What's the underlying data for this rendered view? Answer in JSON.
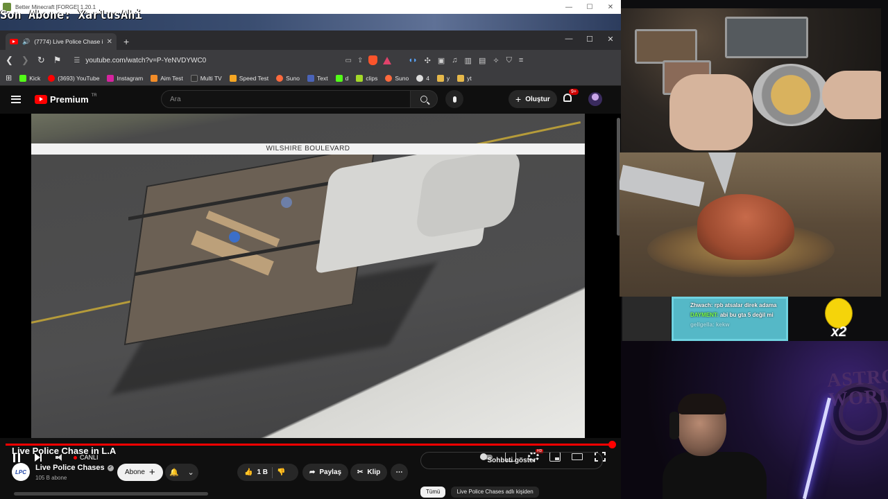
{
  "overlay": {
    "window_title": "Better Minecraft [FORGE] 1.20.1",
    "last_subscriber": "Son Abone: XarlusAhi",
    "window_controls": [
      "—",
      "☐",
      "✕"
    ]
  },
  "browser": {
    "tab_title": "(7774) Live Police Chase in L.A",
    "new_tab_symbol": "+",
    "url": "youtube.com/watch?v=P-YeNVDYWC0",
    "bookmarks": [
      {
        "label": "Kick",
        "color": "#53fc18"
      },
      {
        "label": "(3693) YouTube",
        "color": "#ff0000"
      },
      {
        "label": "Instagram",
        "color": "#d6249f"
      },
      {
        "label": "Aim Test",
        "color": "#f28c28"
      },
      {
        "label": "Multi TV",
        "color": "#333333"
      },
      {
        "label": "Speed Test",
        "color": "#f5a623"
      },
      {
        "label": "Suno",
        "color": "#ff6a3d"
      },
      {
        "label": "Text",
        "color": "#4a63b8"
      },
      {
        "label": "d",
        "color": "#53fc18"
      },
      {
        "label": "clips",
        "color": "#a3d929"
      },
      {
        "label": "Suno",
        "color": "#ff6a3d"
      },
      {
        "label": "4",
        "color": "#dddddd"
      },
      {
        "label": "y",
        "color": "#e6b84a"
      },
      {
        "label": "yt",
        "color": "#e6b84a"
      }
    ]
  },
  "youtube": {
    "logo_text": "Premium",
    "region": "TR",
    "search_placeholder": "Ara",
    "create_label": "Oluştur",
    "notif_count": "9+",
    "video_banner": "WILSHIRE BOULEVARD",
    "live_label": "CANLI",
    "progress": 1.0,
    "video_title": "Live Police Chase in L.A",
    "channel_name": "Live Police Chases",
    "channel_avatar_text": "LPC",
    "subscribers": "105 B abone",
    "subscribe_label": "Abone",
    "likes": "1 B",
    "share_label": "Paylaş",
    "clip_label": "Klip",
    "show_chat_label": "Sohbeti göster",
    "chips": [
      "Tümü",
      "Live Police Chases adlı kişiden"
    ]
  },
  "stream": {
    "chat": [
      {
        "user": "Zhwach:",
        "text": "rpb atsalar direk adama",
        "faded": false
      },
      {
        "user": "DAYMENT:",
        "text": "abi bu gta 5 değil mi",
        "faded": false
      },
      {
        "user": "gellgella:",
        "text": "kekw",
        "faded": true
      }
    ],
    "multiplier": "x2",
    "wall_text": "ASTRO WORLD"
  },
  "colors": {
    "youtube_red": "#ff0000",
    "chat_panel": "#55b8c7",
    "neon": "#7a6bff"
  }
}
